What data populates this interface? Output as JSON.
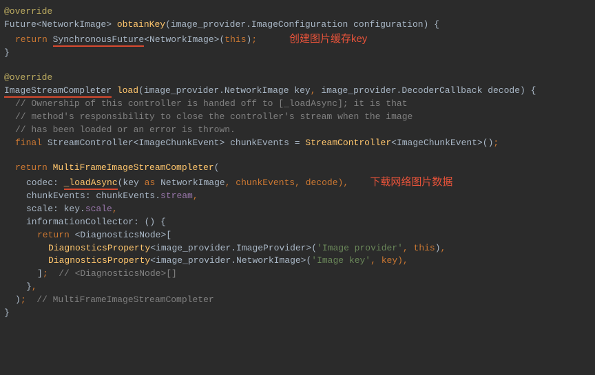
{
  "code": {
    "override": "@override",
    "obtainKey": {
      "returnType_open": "Future<",
      "returnType_inner": "NetworkImage",
      "returnType_close": "> ",
      "name": "obtainKey",
      "params_open": "(image_provider.",
      "params_type": "ImageConfiguration",
      "params_rest": " configuration) {",
      "return_kw": "return ",
      "syncFuture": "SynchronousFuture",
      "syncFuture_gen_open": "<",
      "syncFuture_gen_inner": "NetworkImage",
      "syncFuture_gen_close": ">",
      "syncFuture_args": "(",
      "this_kw": "this",
      "syncFuture_end": ")",
      "semi": ";",
      "close": "}"
    },
    "note_key": "创建图片缓存key",
    "load": {
      "returnType": "ImageStreamCompleter",
      "name": " load",
      "params_open": "(image_provider.",
      "p1_type": "NetworkImage",
      "p1_rest": " key",
      "comma1": ", ",
      "p2_pre": "image_provider.",
      "p2_type": "DecoderCallback",
      "p2_rest": " decode) {",
      "cmt1": "// Ownership of this controller is handed off to [_loadAsync]; it is that",
      "cmt2": "// method's responsibility to close the controller's stream when the image",
      "cmt3": "// has been loaded or an error is thrown.",
      "final_kw": "final ",
      "sc_type": "StreamController",
      "sc_gen_open": "<",
      "sc_gen_inner": "ImageChunkEvent",
      "sc_gen_close": "> ",
      "sc_var": "chunkEvents = ",
      "sc_ctor": "StreamController",
      "sc_ctor_gen_open": "<",
      "sc_ctor_gen_inner": "ImageChunkEvent",
      "sc_ctor_gen_close": ">()",
      "return_kw": "return ",
      "mfisc": "MultiFrameImageStreamCompleter",
      "mfisc_open": "(",
      "codec_label": "codec: ",
      "loadAsync": "_loadAsync",
      "loadAsync_args_open": "(key ",
      "as_kw": "as",
      "loadAsync_args_mid": " ",
      "ni_type": "NetworkImage",
      "loadAsync_args_rest": ", chunkEvents, decode)",
      "comma_codec": ",",
      "note_download": "下载网络图片数据",
      "chunkEvents_line": "chunkEvents: chunkEvents.",
      "chunkEvents_prop": "stream",
      "comma2": ",",
      "scale_line": "scale: key.",
      "scale_prop": "scale",
      "comma3": ",",
      "info_label": "informationCollector: () {",
      "info_return_kw": "return ",
      "diagNode_open": "<",
      "diagNode_type": "DiagnosticsNode",
      "diagNode_close": ">[",
      "dp1_pre": "DiagnosticsProperty",
      "dp1_gen": "<image_provider.ImageProvider>(",
      "dp1_str": "'Image provider'",
      "dp1_mid": ", ",
      "dp1_this": "this",
      "dp1_end": ")",
      "dp1_comma": ",",
      "dp2_pre": "DiagnosticsProperty",
      "dp2_gen": "<image_provider.NetworkImage>(",
      "dp2_str": "'Image key'",
      "dp2_mid": ", key)",
      "dp2_comma": ",",
      "list_close": "]",
      "list_semi": ";",
      "list_cmt": "  // <DiagnosticsNode>[]",
      "info_close": "}",
      "info_comma": ",",
      "mfisc_close": ")",
      "mfisc_semi": ";",
      "mfisc_cmt": "  // MultiFrameImageStreamCompleter",
      "fn_close": "}"
    }
  }
}
